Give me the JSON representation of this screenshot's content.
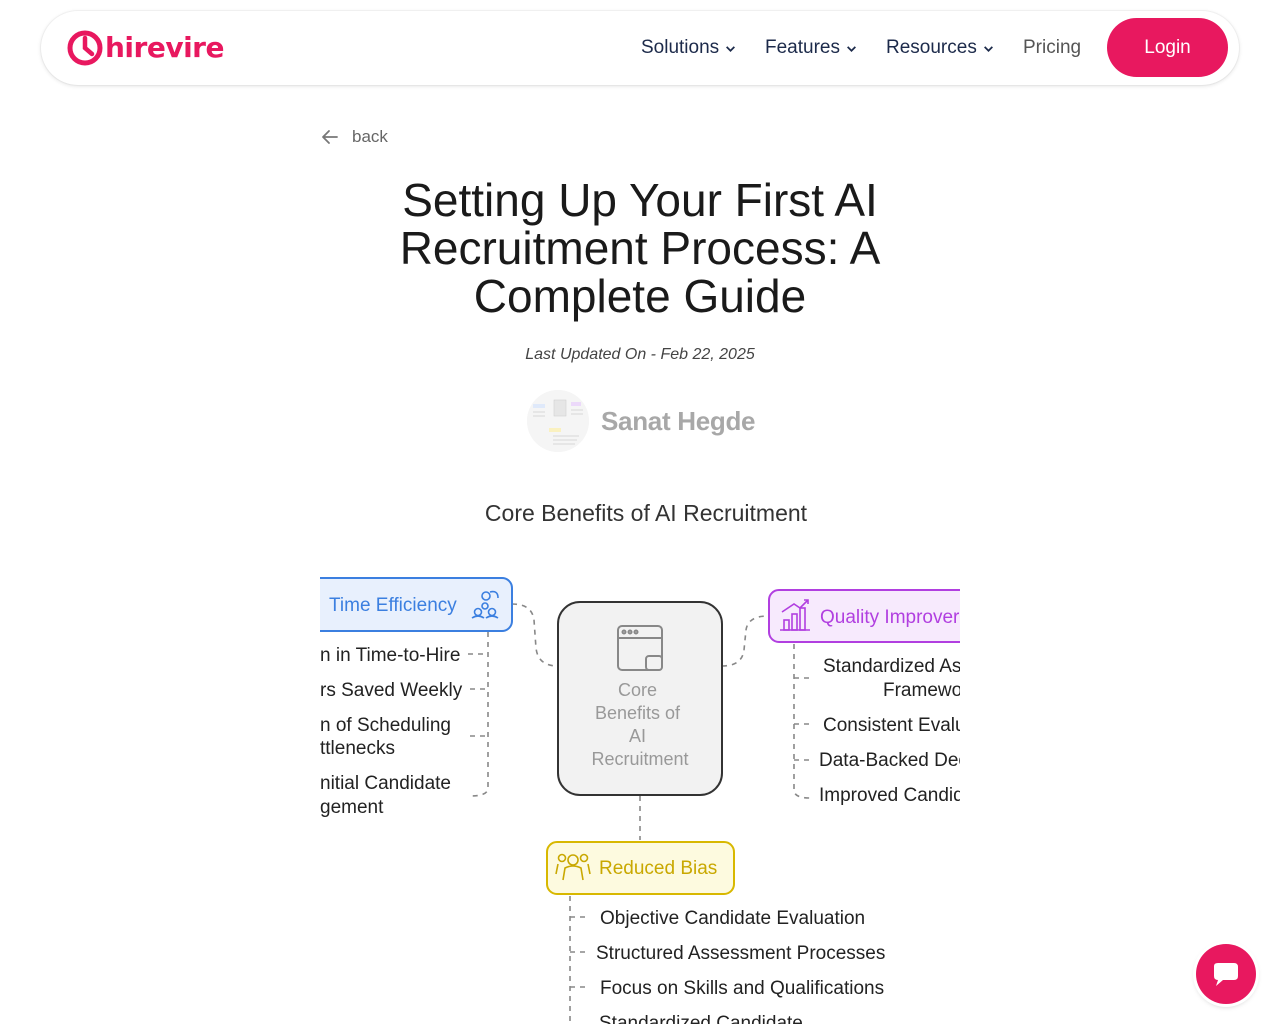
{
  "brand": {
    "name": "hirevire",
    "accent": "#e8185f"
  },
  "nav": {
    "items": [
      {
        "label": "Solutions"
      },
      {
        "label": "Features"
      },
      {
        "label": "Resources"
      },
      {
        "label": "Pricing"
      }
    ],
    "login_label": "Login"
  },
  "article": {
    "back_label": "back",
    "title_lines": [
      "Setting Up Your First AI",
      "Recruitment Process: A",
      "Complete Guide"
    ],
    "updated": "Last Updated On - Feb 22, 2025",
    "author": "Sanat Hegde"
  },
  "diagram": {
    "heading": "Core Benefits of AI Recruitment",
    "center_lines": [
      "Core",
      "Benefits of",
      "AI",
      "Recruitment"
    ],
    "time": {
      "label": "Time Efficiency",
      "color": "#3b7fe0",
      "items": [
        [
          "n in Time-to-Hire"
        ],
        [
          "rs Saved Weekly"
        ],
        [
          "n of Scheduling",
          "ttlenecks"
        ],
        [
          "nitial Candidate",
          "gement"
        ]
      ]
    },
    "quality": {
      "label": "Quality Improver",
      "color": "#b13fe0",
      "items": [
        [
          "Standardized As",
          "Framewo"
        ],
        [
          "Consistent Evalu"
        ],
        [
          "Data-Backed Dec"
        ],
        [
          "Improved Candid"
        ]
      ]
    },
    "bias": {
      "label": "Reduced Bias",
      "color": "#d8b800",
      "items": [
        [
          "Objective Candidate Evaluation"
        ],
        [
          "Structured Assessment Processes"
        ],
        [
          "Focus on Skills and Qualifications"
        ],
        [
          "Standardized Candidate"
        ]
      ]
    }
  },
  "icons": {
    "logo": "hirevire-logo-icon",
    "chevron": "chevron-down-icon",
    "back": "arrow-left-icon",
    "chat": "chat-bubble-icon"
  }
}
